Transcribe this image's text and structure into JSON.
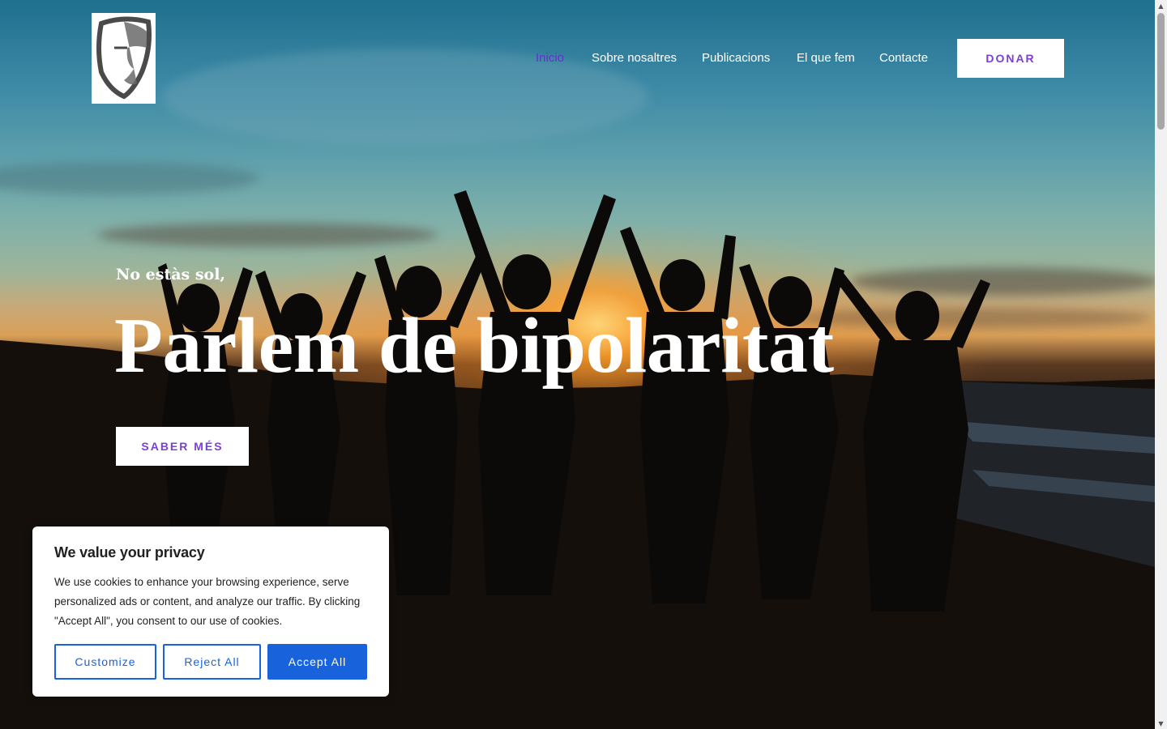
{
  "header": {
    "logo_alt": "Mask logo",
    "nav": [
      {
        "label": "Inicio",
        "active": true
      },
      {
        "label": "Sobre nosaltres",
        "active": false
      },
      {
        "label": "Publicacions",
        "active": false
      },
      {
        "label": "El que fem",
        "active": false
      },
      {
        "label": "Contacte",
        "active": false
      }
    ],
    "donate_label": "DONAR"
  },
  "hero": {
    "subtitle": "No estàs sol,",
    "title": "Parlem de bipolaritat",
    "cta_label": "SABER MÉS"
  },
  "cookie_banner": {
    "title": "We value your privacy",
    "text": "We use cookies to enhance your browsing experience, serve personalized ads or content, and analyze our traffic. By clicking \"Accept All\", you consent to our use of cookies.",
    "customize_label": "Customize",
    "reject_label": "Reject All",
    "accept_label": "Accept All"
  },
  "colors": {
    "accent_purple": "#7b3fd6",
    "active_nav": "#6a2cd8",
    "cookie_blue": "#1863dc"
  },
  "icons": {
    "logo": "mask-icon",
    "scroll_up": "arrow-up-icon",
    "scroll_down": "arrow-down-icon"
  }
}
